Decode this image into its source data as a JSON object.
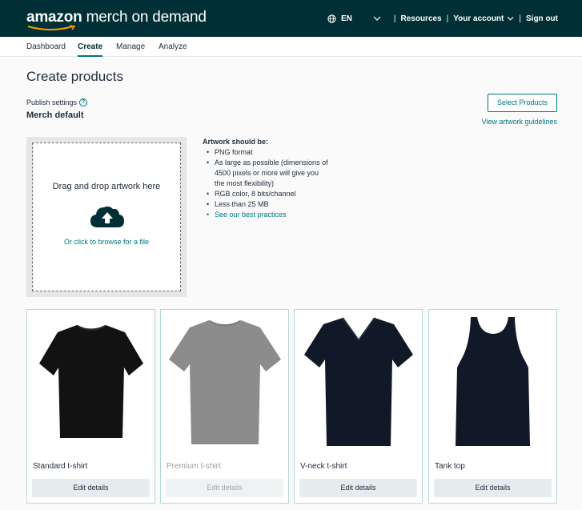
{
  "header": {
    "logo_bold": "amazon",
    "logo_rest": " merch on demand",
    "language": "EN",
    "links": [
      "Resources",
      "Your account",
      "Sign out"
    ],
    "separator": "|"
  },
  "tabs": [
    "Dashboard",
    "Create",
    "Manage",
    "Analyze"
  ],
  "active_tab": "Create",
  "page": {
    "title": "Create products",
    "publish_label": "Publish settings",
    "publish_value": "Merch default",
    "select_button": "Select Products",
    "guidelines_link": "View artwork guidelines"
  },
  "upload": {
    "title": "Drag and drop artwork here",
    "browse": "Or click to browse for a file"
  },
  "requirements": {
    "title": "Artwork should be:",
    "items": [
      "PNG format",
      "As large as possible (dimensions of 4500 pixels or more will give you the most flexibility)",
      "RGB color, 8 bits/channel",
      "Less than 25 MB"
    ],
    "link": "See our best practices"
  },
  "products": [
    {
      "name": "Standard t-shirt",
      "edit": "Edit details",
      "enabled": true
    },
    {
      "name": "Premium t-shirt",
      "edit": "Edit details",
      "enabled": false
    },
    {
      "name": "V-neck t-shirt",
      "edit": "Edit details",
      "enabled": true
    },
    {
      "name": "Tank top",
      "edit": "Edit details",
      "enabled": true
    }
  ],
  "colors": {
    "header_bg": "#002f36",
    "accent": "#00777e",
    "card_border": "#b5d8d8",
    "shirt_dark": "#121212",
    "shirt_gray": "#8c8c8c",
    "shirt_navy": "#111827"
  },
  "icons": [
    "globe-icon",
    "chevron-down-icon",
    "help-icon",
    "upload-cloud-icon"
  ]
}
